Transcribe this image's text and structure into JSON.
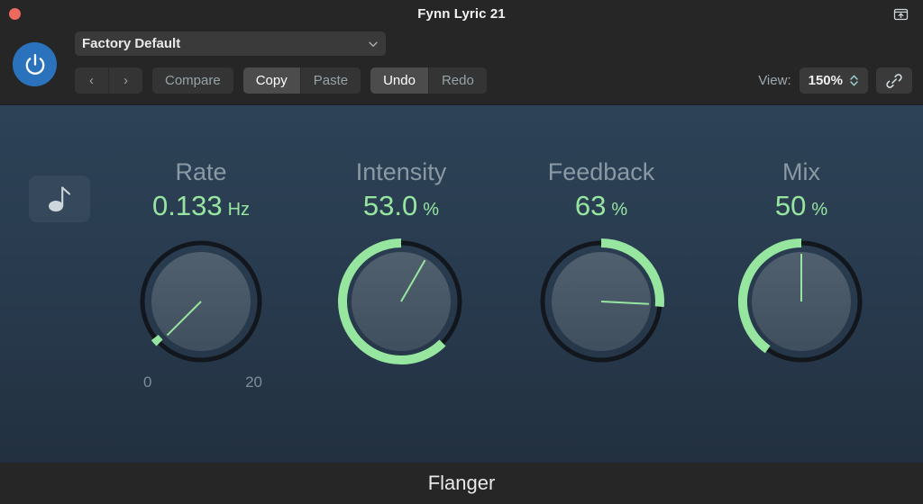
{
  "window": {
    "title": "Fynn Lyric 21",
    "close_icon": "close-dot",
    "export_icon": "export-window-up-arrow-icon"
  },
  "toolbar": {
    "power_icon": "power-icon",
    "preset": {
      "value": "Factory Default",
      "chevron_icon": "chevron-down-icon"
    },
    "prev_label": "‹",
    "next_label": "›",
    "compare_label": "Compare",
    "copy_label": "Copy",
    "paste_label": "Paste",
    "undo_label": "Undo",
    "redo_label": "Redo",
    "view_label": "View:",
    "view_value": "150%",
    "stepper_icon": "up-down-chevron-icon",
    "link_icon": "link-chain-icon"
  },
  "main": {
    "note_button_icon": "eighth-note-icon",
    "accent_color": "#96e6a0",
    "label_color": "#8a99a3",
    "knob_face_color": "#4a5a68",
    "track_color": "#12171d"
  },
  "knobs": [
    {
      "name": "Rate",
      "value": "0.133",
      "unit": "Hz",
      "scale_min": "0",
      "scale_max": "20",
      "arc_start_deg": 225,
      "arc_end_deg": 232,
      "pointer_deg": 225,
      "has_scale": true
    },
    {
      "name": "Intensity",
      "value": "53.0",
      "unit": "%",
      "scale_min": "",
      "scale_max": "",
      "arc_start_deg": 135,
      "arc_end_deg": 360,
      "pointer_deg": 30,
      "has_scale": false
    },
    {
      "name": "Feedback",
      "value": "63",
      "unit": "%",
      "scale_min": "",
      "scale_max": "",
      "arc_start_deg": 0,
      "arc_end_deg": 95,
      "pointer_deg": 93,
      "has_scale": false
    },
    {
      "name": "Mix",
      "value": "50",
      "unit": "%",
      "scale_min": "",
      "scale_max": "",
      "arc_start_deg": 215,
      "arc_end_deg": 360,
      "pointer_deg": 0,
      "has_scale": false
    }
  ],
  "footer": {
    "title": "Flanger"
  }
}
